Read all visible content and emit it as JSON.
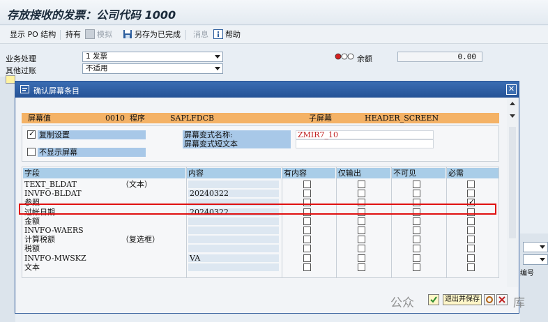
{
  "window": {
    "title": "存放接收的发票：公司代码 1000"
  },
  "toolbar": {
    "show_po": "显示 PO 结构",
    "hold": "持有",
    "simulate": "模拟",
    "save_complete": "另存为已完成",
    "messages": "消息",
    "help": "帮助"
  },
  "form": {
    "transaction_label": "业务处理",
    "transaction_value": "1 发票",
    "other_posting_label": "其他过账",
    "other_posting_value": "不适用",
    "balance_label": "余额",
    "balance_value": "0.00"
  },
  "bg_right": {
    "col_label": "编号"
  },
  "dialog": {
    "title": "确认屏幕条目",
    "header": {
      "screen_value_label": "屏幕值",
      "screen_number": "0010",
      "program_label": "程序",
      "program": "SAPLFDCB",
      "subscreen_label": "子屏幕",
      "subscreen": "HEADER_SCREEN"
    },
    "copy_settings": "复制设置",
    "hide_screen": "不显示屏幕",
    "variant_name_label": "屏幕变式名称:",
    "variant_name_value": "ZMIR7_10",
    "variant_short_text_label": "屏幕变式短文本",
    "columns": {
      "field": "字段",
      "content": "内容",
      "with_content": "有内容",
      "output_only": "仅输出",
      "invisible": "不可见",
      "required": "必需"
    },
    "rows": [
      {
        "field": "TEXT_BLDAT",
        "note": "（文本）",
        "content": "",
        "required": false
      },
      {
        "field": "INVFO-BLDAT",
        "note": "",
        "content": "20240322",
        "required": false
      },
      {
        "field": "参照",
        "note": "",
        "content": "",
        "required": true
      },
      {
        "field": "过帐日期",
        "note": "",
        "content": "20240322",
        "required": false
      },
      {
        "field": "金额",
        "note": "",
        "content": "",
        "required": false
      },
      {
        "field": "INVFO-WAERS",
        "note": "",
        "content": "",
        "required": false
      },
      {
        "field": "计算税额",
        "note": "（复选框）",
        "content": "",
        "required": false
      },
      {
        "field": "税额",
        "note": "",
        "content": "",
        "required": false
      },
      {
        "field": "INVFO-MWSKZ",
        "note": "",
        "content": "VA",
        "required": false
      },
      {
        "field": "文本",
        "note": "",
        "content": "",
        "required": false
      }
    ],
    "exit_save_button": "退出并保存"
  },
  "watermark": {
    "left": "公众",
    "right": "库"
  },
  "colors": {
    "dialog_header": "#255296",
    "orange_bar": "#f4b266",
    "highlight_box": "#e01010"
  }
}
